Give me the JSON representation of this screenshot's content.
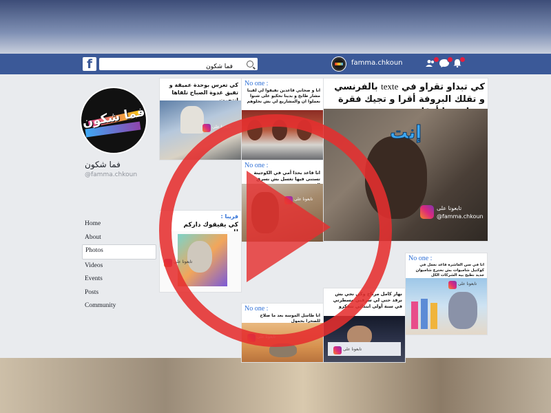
{
  "topbar": {
    "search_value": "فما شكون",
    "profile_name": "famma.chkoun"
  },
  "profile": {
    "name": "فما شكون",
    "handle": "@famma.chkoun"
  },
  "menu": [
    {
      "label": "Home"
    },
    {
      "label": "About"
    },
    {
      "label": "Photos",
      "active": true
    },
    {
      "label": "Videos"
    },
    {
      "label": "Events"
    },
    {
      "label": "Posts"
    },
    {
      "label": "Community"
    }
  ],
  "posts": {
    "p1_caption": "كي تعرس بوحدة عميقة و تفيق غدوة الصباح تلقاها انتحرت",
    "p2_noone": "No one :",
    "p2_caption": "انا و صحابي قاعدين نفيقوا لي لقينا مشار طابخ و بدينا نحكيو على شنوا نعملوا ان والمشاريع لي بش نحلوهم",
    "p3_caption_a": "كي تبداو تقراو في",
    "p3_caption_b": "texte",
    "p3_caption_c": "بالفرنسي و تقلك البروفة أقرا و تجيك فقرة فيها برشا أرقام",
    "p3_big": "إنت",
    "p3_ig": "@famma.chkoun",
    "p3_ig_ar": "تابعونا على",
    "p4_noone": "No one :",
    "p4_caption": "انا قاعد بحذا أمي في الكوجينة تستنى فيها تغسل بش نسرق الفريت",
    "p5_label": "فريبا :",
    "p5_caption": "كي يفيقوك داركم للسحور",
    "p6_noone": "No one :",
    "p6_caption": "انا في سن العاشرة قاعد نعمل في كوكتيل شامبوات بش نخترع شامبوان جديد نطيح بيه الشركات الكل",
    "p7_noone": "No one :",
    "p7_caption": "انا طاسل الموسة بعد ما صلاح للصحرا بحمول",
    "p8_caption": "نهار كامل مرتاح وكي نجي بش نرقد حتى لي سرقني مسطرتي في سنة أولى ابتدائي تتفكرو"
  }
}
